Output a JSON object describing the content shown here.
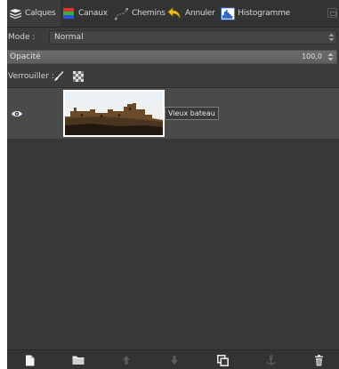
{
  "tabs": [
    {
      "label": "Calques",
      "icon": "layers-icon",
      "active": true
    },
    {
      "label": "Canaux",
      "icon": "channels-icon",
      "active": false
    },
    {
      "label": "Chemins",
      "icon": "paths-icon",
      "active": false
    },
    {
      "label": "Annuler",
      "icon": "undo-icon",
      "active": false
    },
    {
      "label": "Histogramme",
      "icon": "histogram-icon",
      "active": false
    }
  ],
  "mode": {
    "label": "Mode :",
    "value": "Normal"
  },
  "opacity": {
    "label": "Opacité",
    "value": "100,0",
    "level": 1.0
  },
  "lock": {
    "label": "Verrouiller :",
    "icons": [
      "paint-lock-icon",
      "alpha-lock-icon"
    ]
  },
  "layers": [
    {
      "name": "Vieux bateau",
      "visible": true,
      "selected": true
    }
  ],
  "bottom_buttons": [
    "new-layer-icon",
    "new-group-icon",
    "raise-layer-icon",
    "lower-layer-icon",
    "duplicate-layer-icon",
    "anchor-layer-icon",
    "delete-layer-icon"
  ],
  "colors": {
    "panel_bg": "#3c3c3c",
    "selected_row": "#4a4a4a",
    "text": "#d2d2d2"
  }
}
